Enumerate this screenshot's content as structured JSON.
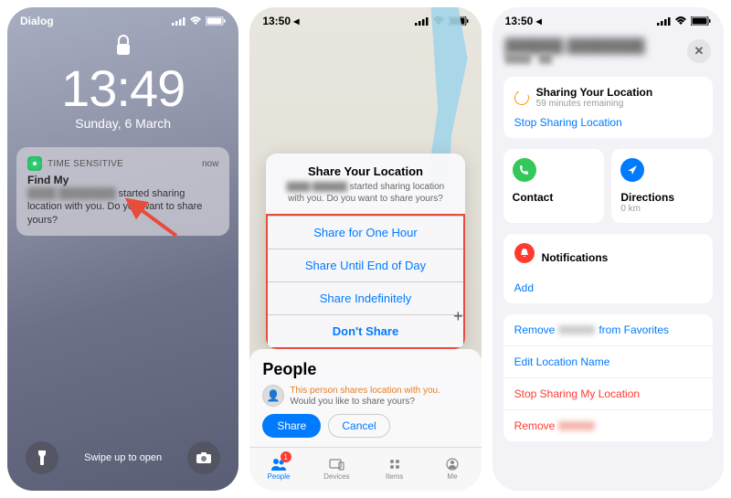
{
  "screen1": {
    "carrier": "Dialog",
    "time": "13:49",
    "date": "Sunday, 6 March",
    "notif": {
      "sensitive": "TIME SENSITIVE",
      "ago": "now",
      "app": "Find My",
      "msg_suffix": " started sharing location with you. Do you want to share yours?"
    },
    "swipe": "Swipe up to open"
  },
  "screen2": {
    "time": "13:50",
    "dialog": {
      "title": "Share Your Location",
      "msg_suffix": " started sharing location with you. Do you want to share yours?",
      "opts": [
        "Share for One Hour",
        "Share Until End of Day",
        "Share Indefinitely",
        "Don't Share"
      ]
    },
    "sheet": {
      "title": "People",
      "line1": "This person shares location with you.",
      "line2": "Would you like to share yours?",
      "share": "Share",
      "cancel": "Cancel"
    },
    "tabs": {
      "people": "People",
      "devices": "Devices",
      "items": "Items",
      "me": "Me",
      "badge": "1"
    }
  },
  "screen3": {
    "time": "13:50",
    "share_card": {
      "title": "Sharing Your Location",
      "sub": "59 minutes remaining",
      "link": "Stop Sharing Location"
    },
    "contact": "Contact",
    "directions": {
      "title": "Directions",
      "sub": "0 km"
    },
    "notifications": {
      "title": "Notifications",
      "add": "Add"
    },
    "links": {
      "remove_fav_pre": "Remove ",
      "remove_fav_post": " from Favorites",
      "edit": "Edit Location Name",
      "stop": "Stop Sharing My Location",
      "remove": "Remove "
    }
  }
}
